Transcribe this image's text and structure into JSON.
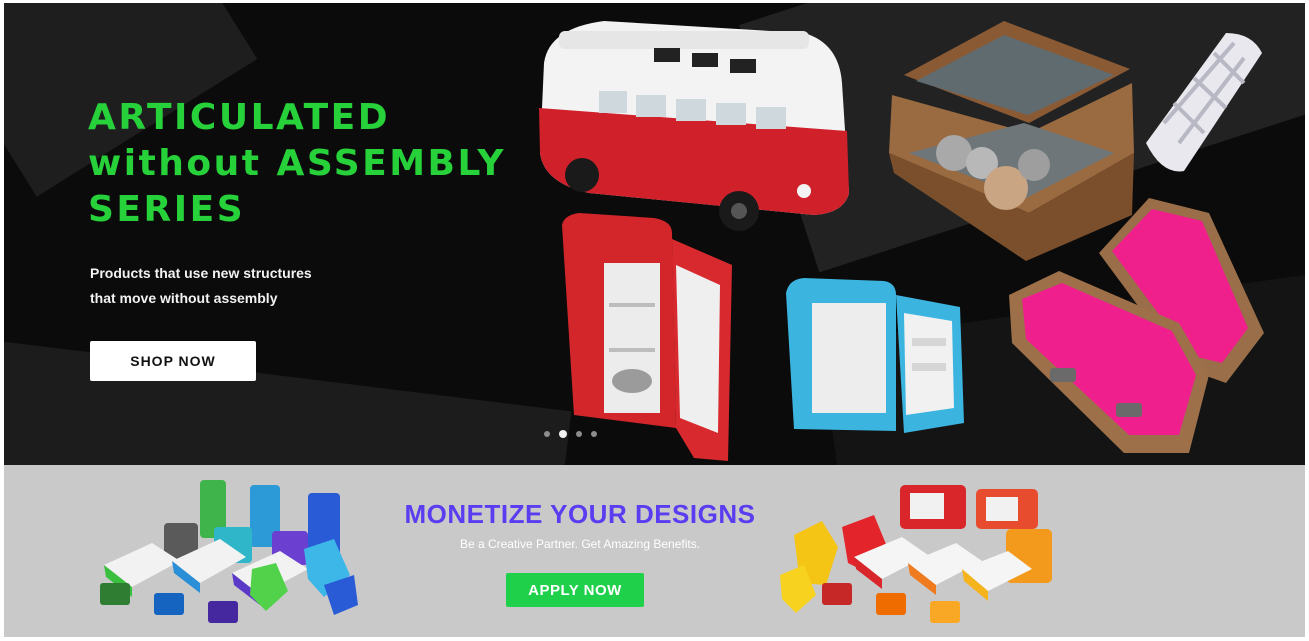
{
  "hero": {
    "title_lines": [
      "ARTICULATED",
      "without ASSEMBLY",
      "SERIES"
    ],
    "subtitle_lines": [
      "Products that use new structures",
      "that move without assembly"
    ],
    "cta_label": "SHOP NOW",
    "slides": {
      "count": 4,
      "active": 2
    },
    "products": [
      "toy-bus",
      "treasure-chest",
      "lattice-cylinder",
      "red-fridge",
      "blue-fridge",
      "coffin"
    ]
  },
  "promo": {
    "title": "MONETIZE YOUR DESIGNS",
    "subtitle": "Be a Creative Partner. Get Amazing Benefits.",
    "cta_label": "APPLY NOW",
    "images": [
      "colorful-toy-collection-left",
      "colorful-toy-collection-right"
    ]
  },
  "colors": {
    "hero_bg": "#0b0b0b",
    "hero_title": "#27d13a",
    "promo_bg": "#c9c9c9",
    "promo_title": "#5a3df0",
    "apply_button": "#1fd14a"
  }
}
